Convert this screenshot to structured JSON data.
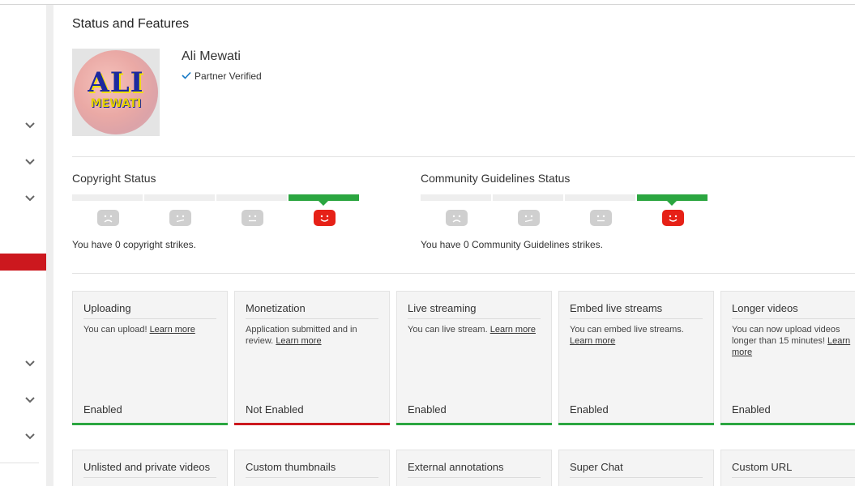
{
  "page": {
    "title": "Status and Features"
  },
  "channel": {
    "name": "Ali Mewati",
    "verified_label": "Partner Verified",
    "avatar_line1": "ALI",
    "avatar_line2": "MEWATI"
  },
  "copyright": {
    "title": "Copyright Status",
    "strikes_text": "You have 0 copyright strikes."
  },
  "community": {
    "title": "Community Guidelines Status",
    "strikes_text": "You have 0 Community Guidelines strikes."
  },
  "features_row1": [
    {
      "title": "Uploading",
      "desc": "You can upload!",
      "link": "Learn more",
      "status": "Enabled"
    },
    {
      "title": "Monetization",
      "desc": "Application submitted and in review.",
      "link": "Learn more",
      "status": "Not Enabled"
    },
    {
      "title": "Live streaming",
      "desc": "You can live stream.",
      "link": "Learn more",
      "status": "Enabled"
    },
    {
      "title": "Embed live streams",
      "desc": "You can embed live streams.",
      "link": "Learn more",
      "status": "Enabled"
    },
    {
      "title": "Longer videos",
      "desc": "You can now upload videos longer than 15 minutes!",
      "link": "Learn more",
      "status": "Enabled"
    }
  ],
  "features_row2": [
    {
      "title": "Unlisted and private videos"
    },
    {
      "title": "Custom thumbnails"
    },
    {
      "title": "External annotations"
    },
    {
      "title": "Super Chat"
    },
    {
      "title": "Custom URL"
    }
  ],
  "colors": {
    "enabled": "#2ba640",
    "not_enabled": "#cc181e",
    "sidebar_active": "#cc181e",
    "strike_good": "#e62117"
  },
  "icons": {
    "sidebar_chevron": "chevron-down-icon",
    "verified": "checkmark-icon",
    "faces": [
      "frown-face-icon",
      "unsure-face-icon",
      "neutral-face-icon",
      "smile-face-icon"
    ]
  }
}
